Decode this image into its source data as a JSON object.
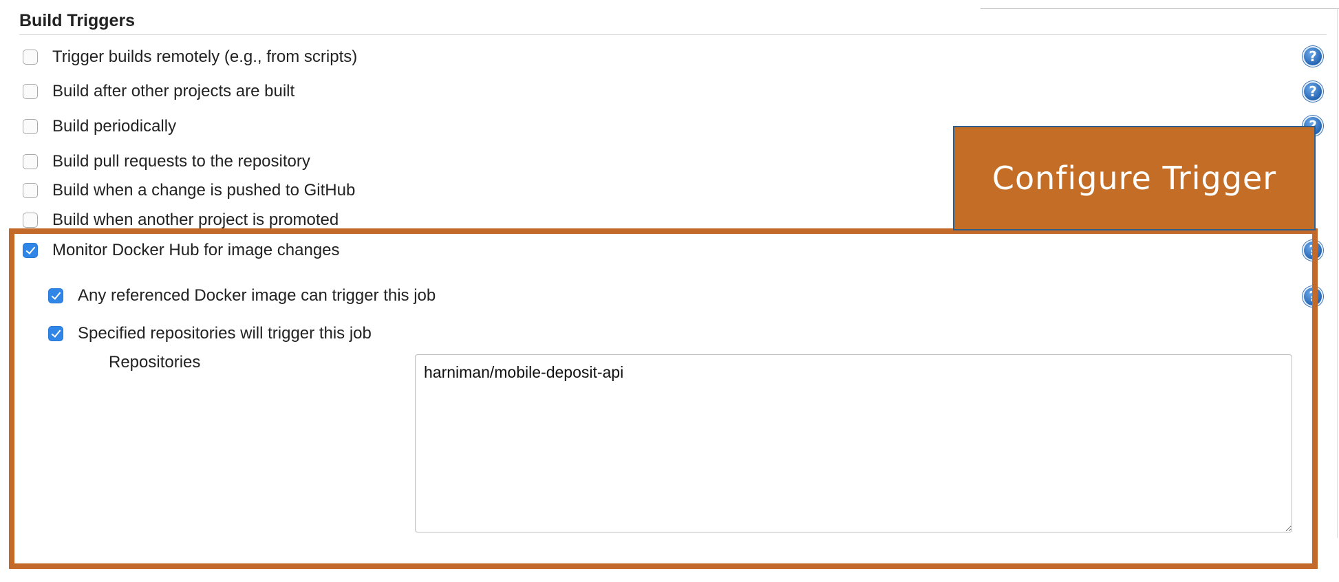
{
  "section": {
    "title": "Build Triggers"
  },
  "triggers": [
    {
      "label": "Trigger builds remotely (e.g., from scripts)",
      "checked": false
    },
    {
      "label": "Build after other projects are built",
      "checked": false
    },
    {
      "label": "Build periodically",
      "checked": false
    },
    {
      "label": "Build pull requests to the repository",
      "checked": false
    },
    {
      "label": "Build when a change is pushed to GitHub",
      "checked": false
    },
    {
      "label": "Build when another project is promoted",
      "checked": false
    },
    {
      "label": "Monitor Docker Hub for image changes",
      "checked": true
    }
  ],
  "docker_options": [
    {
      "label": "Any referenced Docker image can trigger this job",
      "checked": true
    },
    {
      "label": "Specified repositories will trigger this job",
      "checked": true
    }
  ],
  "repositories": {
    "label": "Repositories",
    "value": "harniman/mobile-deposit-api"
  },
  "callout": {
    "text": "Configure Trigger"
  },
  "icons": {
    "help": "help-icon",
    "checkbox_checked": "check-icon",
    "help_glyph": "?"
  },
  "colors": {
    "callout_bg": "#c46d27",
    "highlight_border": "#c36a2a",
    "checkbox_checked": "#2f86e7",
    "help_icon": "#1f5fae"
  }
}
